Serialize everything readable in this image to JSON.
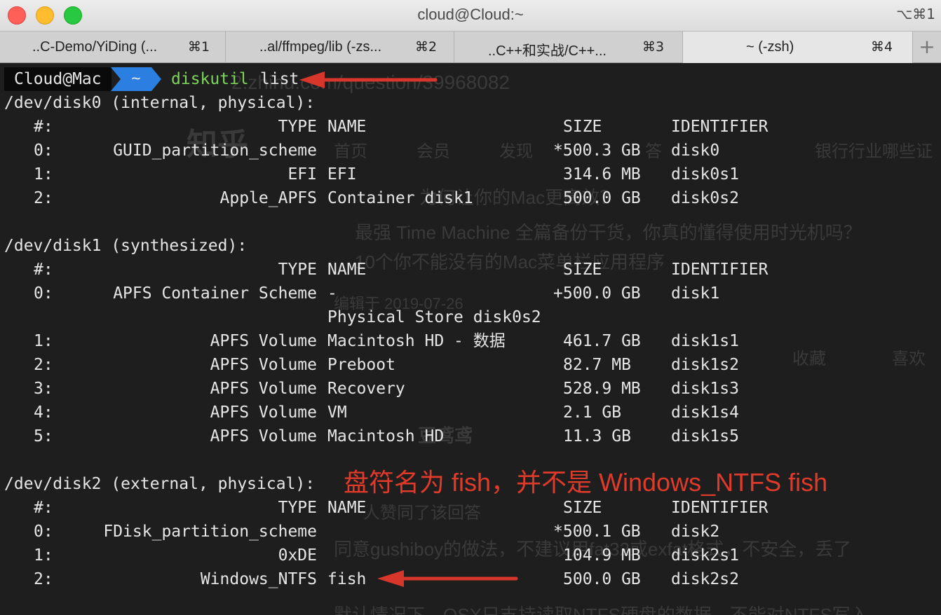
{
  "window": {
    "title": "cloud@Cloud:~",
    "shortcut": "⌥⌘1"
  },
  "tabs": [
    {
      "title": "..C-Demo/YiDing (...",
      "shortcut": "⌘1"
    },
    {
      "title": "..al/ffmpeg/lib (-zs...",
      "shortcut": "⌘2"
    },
    {
      "title": "..C++和实战/C++...",
      "shortcut": "⌘3"
    },
    {
      "title": "~ (-zsh)",
      "shortcut": "⌘4"
    }
  ],
  "prompt": {
    "user": "Cloud@Mac",
    "dir": "~",
    "command": "diskutil",
    "arg": "list"
  },
  "disks": [
    {
      "header": "/dev/disk0 (internal, physical):",
      "columns": [
        "#:",
        "TYPE",
        "NAME",
        "SIZE",
        "IDENTIFIER"
      ],
      "rows": [
        {
          "num": "0:",
          "type": "GUID_partition_scheme",
          "name": "",
          "size": "*500.3 GB",
          "id": "disk0"
        },
        {
          "num": "1:",
          "type": "EFI",
          "name": "EFI",
          "size": "314.6 MB",
          "id": "disk0s1"
        },
        {
          "num": "2:",
          "type": "Apple_APFS",
          "name": "Container disk1",
          "size": "500.0 GB",
          "id": "disk0s2"
        }
      ]
    },
    {
      "header": "/dev/disk1 (synthesized):",
      "columns": [
        "#:",
        "TYPE",
        "NAME",
        "SIZE",
        "IDENTIFIER"
      ],
      "rows": [
        {
          "num": "0:",
          "type": "APFS Container Scheme",
          "name": "-",
          "size": "+500.0 GB",
          "id": "disk1"
        },
        {
          "num": "",
          "type": "",
          "name": "Physical Store disk0s2",
          "size": "",
          "id": ""
        },
        {
          "num": "1:",
          "type": "APFS Volume",
          "name": "Macintosh HD - 数据",
          "size": "461.7 GB",
          "id": "disk1s1"
        },
        {
          "num": "2:",
          "type": "APFS Volume",
          "name": "Preboot",
          "size": "82.7 MB",
          "id": "disk1s2"
        },
        {
          "num": "3:",
          "type": "APFS Volume",
          "name": "Recovery",
          "size": "528.9 MB",
          "id": "disk1s3"
        },
        {
          "num": "4:",
          "type": "APFS Volume",
          "name": "VM",
          "size": "2.1 GB",
          "id": "disk1s4"
        },
        {
          "num": "5:",
          "type": "APFS Volume",
          "name": "Macintosh HD",
          "size": "11.3 GB",
          "id": "disk1s5"
        }
      ]
    },
    {
      "header": "/dev/disk2 (external, physical):",
      "columns": [
        "#:",
        "TYPE",
        "NAME",
        "SIZE",
        "IDENTIFIER"
      ],
      "rows": [
        {
          "num": "0:",
          "type": "FDisk_partition_scheme",
          "name": "",
          "size": "*500.1 GB",
          "id": "disk2"
        },
        {
          "num": "1:",
          "type": "0xDE",
          "name": "",
          "size": "104.9 MB",
          "id": "disk2s1"
        },
        {
          "num": "2:",
          "type": "Windows_NTFS",
          "name": "fish",
          "size": "500.0 GB",
          "id": "disk2s2"
        }
      ]
    }
  ],
  "annotation": "盘符名为 fish，并不是 Windows_NTFS fish",
  "background_text": [
    "2.zhihu.com/question/39968082",
    "知乎",
    "首页",
    "会员",
    "发现",
    "答",
    "银行行业哪些证",
    "为何让你的Mac更高效？",
    "最强 Time Machine 全篇备份干货，你真的懂得使用时光机吗？",
    "10个你不能没有的Mac菜单栏应用程序",
    "编辑于 2019-07-26",
    "收藏",
    "喜欢",
    "豆鸢鸢",
    "人赞同了该回答",
    "同意gushiboy的做法，不建议用fat32或exfat格式，不安全，丢了",
    "默认情况下，OSX只支持读取NTFS硬盘的数据，不能对NTFS写入"
  ],
  "colors": {
    "terminal_bg": "#1e1e1e",
    "text": "#e6e6e6",
    "command_green": "#7dd65a",
    "prompt_blue": "#2b7fe0",
    "annotation_red": "#e03a2b"
  }
}
